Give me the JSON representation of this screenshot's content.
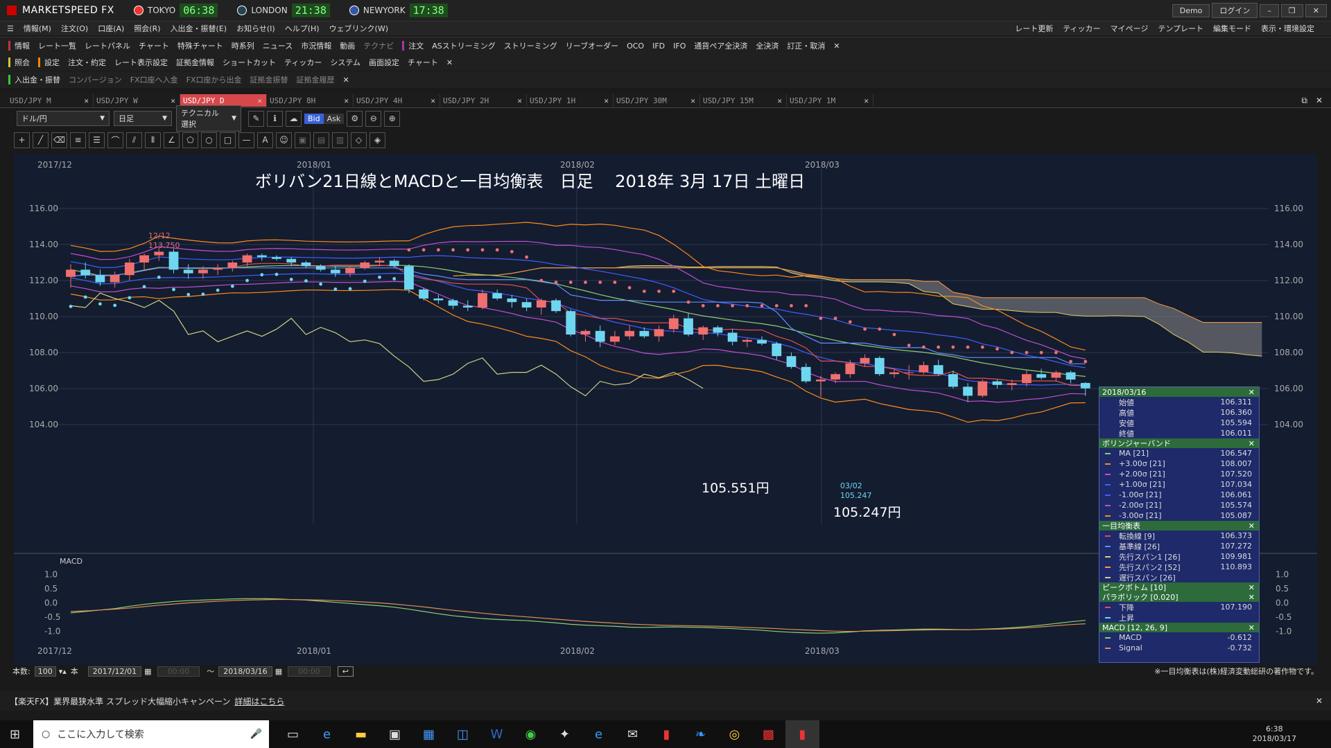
{
  "app": {
    "title": "MARKETSPEED FX",
    "clocks": [
      {
        "city": "TOKYO",
        "time": "06:38"
      },
      {
        "city": "LONDON",
        "time": "21:38"
      },
      {
        "city": "NEWYORK",
        "time": "17:38"
      }
    ],
    "demo": "Demo",
    "login": "ログイン"
  },
  "menu": [
    "情報(M)",
    "注文(O)",
    "口座(A)",
    "照会(R)",
    "入出金・振替(E)",
    "お知らせ(I)",
    "ヘルプ(H)",
    "ウェブリンク(W)"
  ],
  "menu_right": [
    "レート更新",
    "ティッカー",
    "マイページ",
    "テンプレート",
    "編集モード",
    "表示・環境設定"
  ],
  "toolbar1": [
    "情報",
    "レート一覧",
    "レートパネル",
    "チャート",
    "特殊チャート",
    "時系列",
    "ニュース",
    "市況情報",
    "動画",
    "テクナビ",
    "注文",
    "ASストリーミング",
    "ストリーミング",
    "リーブオーダー",
    "OCO",
    "IFD",
    "IFO",
    "通貨ペア全決済",
    "全決済",
    "訂正・取消"
  ],
  "toolbar2": [
    "照会",
    "設定",
    "注文・約定",
    "レート表示設定",
    "証拠金情報",
    "ショートカット",
    "ティッカー",
    "システム",
    "画面設定",
    "チャート"
  ],
  "toolbar3": [
    "入出金・振替",
    "コンバージョン",
    "FX口座へ入金",
    "FX口座から出金",
    "証拠金振替",
    "証拠金履歴"
  ],
  "tabs": [
    "USD/JPY M",
    "USD/JPY W",
    "USD/JPY D",
    "USD/JPY 8H",
    "USD/JPY 4H",
    "USD/JPY 2H",
    "USD/JPY 1H",
    "USD/JPY 30M",
    "USD/JPY 15M",
    "USD/JPY 1M"
  ],
  "active_tab": 2,
  "controls": {
    "pair": "ドル/円",
    "period": "日足",
    "technical": "テクニカル選択",
    "bid": "Bid",
    "ask": "Ask"
  },
  "chart": {
    "annotation_title": "ボリバン21日線とMACDと一目均衡表　日足　 2018年 3月 17日 土曜日",
    "top_dates": [
      "2017/12",
      "2018/01",
      "2018/02",
      "2018/03"
    ],
    "bottom_dates": [
      "2017/12",
      "2018/01",
      "2018/02",
      "2018/03"
    ],
    "y_ticks": [
      "116.00",
      "114.00",
      "112.00",
      "110.00",
      "108.00",
      "106.00",
      "104.00"
    ],
    "macd_label": "MACD",
    "macd_ticks": [
      "1.0",
      "0.5",
      "0.0",
      "-0.5",
      "-1.0"
    ],
    "peak_label_date": "12/12",
    "peak_label_value": "113.750",
    "low_label_date": "03/02",
    "low_label_value": "105.247",
    "callout_1": "105.551円",
    "callout_2": "105.247円",
    "colors": {
      "up": "#ef6f6f",
      "down": "#6fd6ef",
      "bg": "#141c30"
    }
  },
  "chart_data": {
    "type": "candlestick",
    "x_start": "2017/12/01",
    "x_end": "2018/03/16",
    "ylim": [
      102.5,
      117.5
    ],
    "ohlc": [
      [
        112.2,
        112.9,
        111.6,
        112.6
      ],
      [
        112.6,
        113.0,
        112.1,
        112.3
      ],
      [
        112.3,
        112.6,
        111.7,
        111.9
      ],
      [
        111.9,
        112.5,
        111.6,
        112.3
      ],
      [
        112.3,
        113.2,
        112.0,
        113.0
      ],
      [
        113.0,
        113.5,
        112.6,
        113.4
      ],
      [
        113.4,
        113.8,
        113.1,
        113.6
      ],
      [
        113.6,
        113.75,
        112.4,
        112.6
      ],
      [
        112.6,
        112.9,
        112.1,
        112.4
      ],
      [
        112.4,
        112.8,
        112.1,
        112.6
      ],
      [
        112.6,
        112.9,
        112.3,
        112.7
      ],
      [
        112.7,
        113.1,
        112.5,
        113.0
      ],
      [
        113.0,
        113.5,
        112.8,
        113.4
      ],
      [
        113.4,
        113.5,
        113.1,
        113.3
      ],
      [
        113.3,
        113.4,
        113.1,
        113.2
      ],
      [
        113.2,
        113.3,
        112.8,
        113.0
      ],
      [
        113.0,
        113.1,
        112.7,
        112.8
      ],
      [
        112.8,
        112.9,
        112.5,
        112.6
      ],
      [
        112.6,
        112.8,
        112.2,
        112.4
      ],
      [
        112.4,
        112.8,
        112.2,
        112.7
      ],
      [
        112.7,
        113.1,
        112.6,
        113.0
      ],
      [
        113.0,
        113.3,
        112.8,
        113.1
      ],
      [
        113.1,
        113.2,
        112.7,
        112.8
      ],
      [
        112.8,
        112.9,
        111.3,
        111.5
      ],
      [
        111.5,
        111.6,
        110.9,
        111.0
      ],
      [
        111.0,
        111.2,
        110.7,
        110.9
      ],
      [
        110.9,
        111.0,
        110.4,
        110.6
      ],
      [
        110.6,
        110.9,
        110.3,
        110.5
      ],
      [
        110.5,
        111.5,
        110.4,
        111.3
      ],
      [
        111.3,
        111.5,
        110.9,
        111.0
      ],
      [
        111.0,
        111.2,
        110.5,
        110.8
      ],
      [
        110.8,
        111.0,
        110.3,
        110.5
      ],
      [
        110.5,
        111.0,
        110.1,
        110.9
      ],
      [
        110.9,
        111.0,
        110.2,
        110.3
      ],
      [
        110.3,
        110.4,
        108.9,
        109.0
      ],
      [
        109.0,
        109.3,
        108.6,
        109.2
      ],
      [
        109.2,
        109.5,
        108.3,
        108.6
      ],
      [
        108.6,
        109.2,
        108.4,
        108.9
      ],
      [
        108.9,
        109.5,
        108.7,
        109.2
      ],
      [
        109.2,
        109.4,
        108.8,
        108.9
      ],
      [
        108.9,
        109.5,
        108.6,
        109.3
      ],
      [
        109.3,
        110.1,
        109.1,
        109.9
      ],
      [
        109.9,
        110.2,
        108.9,
        109.0
      ],
      [
        109.0,
        109.5,
        108.7,
        109.4
      ],
      [
        109.4,
        109.5,
        108.9,
        109.1
      ],
      [
        109.1,
        109.3,
        108.4,
        108.6
      ],
      [
        108.6,
        108.8,
        108.3,
        108.7
      ],
      [
        108.7,
        108.9,
        108.4,
        108.5
      ],
      [
        108.5,
        108.6,
        107.6,
        107.8
      ],
      [
        107.8,
        108.0,
        107.1,
        107.2
      ],
      [
        107.2,
        107.4,
        106.3,
        106.4
      ],
      [
        106.4,
        106.7,
        105.55,
        106.5
      ],
      [
        106.5,
        106.9,
        106.3,
        106.8
      ],
      [
        106.8,
        107.6,
        106.6,
        107.4
      ],
      [
        107.4,
        107.9,
        107.2,
        107.7
      ],
      [
        107.7,
        107.8,
        106.7,
        106.8
      ],
      [
        106.8,
        107.1,
        106.6,
        106.9
      ],
      [
        106.9,
        107.3,
        106.5,
        106.9
      ],
      [
        106.9,
        107.5,
        106.8,
        107.3
      ],
      [
        107.3,
        107.6,
        106.7,
        106.8
      ],
      [
        106.8,
        107.0,
        106.0,
        106.1
      ],
      [
        106.1,
        106.3,
        105.247,
        105.6
      ],
      [
        105.6,
        106.5,
        105.5,
        106.4
      ],
      [
        106.4,
        106.5,
        106.0,
        106.2
      ],
      [
        106.2,
        106.5,
        105.9,
        106.3
      ],
      [
        106.3,
        107.0,
        106.1,
        106.8
      ],
      [
        106.8,
        107.1,
        106.5,
        106.6
      ],
      [
        106.6,
        107.0,
        106.4,
        106.9
      ],
      [
        106.9,
        107.0,
        106.3,
        106.5
      ],
      [
        106.311,
        106.36,
        105.594,
        106.011
      ]
    ],
    "macd": [
      -0.35,
      -0.3,
      -0.25,
      -0.2,
      -0.12,
      -0.05,
      0.0,
      0.05,
      0.08,
      0.1,
      0.12,
      0.14,
      0.15,
      0.15,
      0.14,
      0.12,
      0.1,
      0.06,
      0.02,
      -0.02,
      -0.06,
      -0.1,
      -0.15,
      -0.22,
      -0.3,
      -0.38,
      -0.45,
      -0.5,
      -0.55,
      -0.58,
      -0.6,
      -0.62,
      -0.66,
      -0.7,
      -0.75,
      -0.78,
      -0.8,
      -0.82,
      -0.85,
      -0.86,
      -0.85,
      -0.84,
      -0.85,
      -0.86,
      -0.88,
      -0.9,
      -0.93,
      -0.96,
      -1.0,
      -1.03,
      -1.05,
      -1.06,
      -1.05,
      -1.02,
      -0.98,
      -0.96,
      -0.95,
      -0.93,
      -0.92,
      -0.92,
      -0.93,
      -0.94,
      -0.92,
      -0.9,
      -0.87,
      -0.83,
      -0.78,
      -0.72,
      -0.66,
      -0.612
    ],
    "signal": [
      -0.3,
      -0.28,
      -0.25,
      -0.22,
      -0.18,
      -0.13,
      -0.08,
      -0.04,
      0.0,
      0.03,
      0.06,
      0.08,
      0.1,
      0.11,
      0.12,
      0.12,
      0.11,
      0.1,
      0.08,
      0.06,
      0.03,
      0.0,
      -0.04,
      -0.09,
      -0.14,
      -0.2,
      -0.26,
      -0.31,
      -0.36,
      -0.41,
      -0.45,
      -0.49,
      -0.53,
      -0.57,
      -0.61,
      -0.65,
      -0.68,
      -0.71,
      -0.74,
      -0.76,
      -0.78,
      -0.79,
      -0.8,
      -0.81,
      -0.82,
      -0.84,
      -0.86,
      -0.88,
      -0.9,
      -0.93,
      -0.95,
      -0.97,
      -0.99,
      -1.0,
      -0.99,
      -0.98,
      -0.97,
      -0.96,
      -0.95,
      -0.94,
      -0.94,
      -0.94,
      -0.93,
      -0.92,
      -0.9,
      -0.87,
      -0.84,
      -0.8,
      -0.76,
      -0.732
    ]
  },
  "info_panel": {
    "date": "2018/03/16",
    "ohlc": [
      [
        "始値",
        "106.311"
      ],
      [
        "高値",
        "106.360"
      ],
      [
        "安値",
        "105.594"
      ],
      [
        "終値",
        "106.011"
      ]
    ],
    "bb_title": "ボリンジャーバンド",
    "bb": [
      [
        "MA [21]",
        "106.547",
        "#8fd070"
      ],
      [
        "+3.00σ [21]",
        "108.007",
        "#ff8c1a"
      ],
      [
        "+2.00σ [21]",
        "107.520",
        "#c050d0"
      ],
      [
        "+1.00σ [21]",
        "107.034",
        "#4060ff"
      ],
      [
        "-1.00σ [21]",
        "106.061",
        "#4060ff"
      ],
      [
        "-2.00σ [21]",
        "105.574",
        "#c050d0"
      ],
      [
        "-3.00σ [21]",
        "105.087",
        "#ff8c1a"
      ]
    ],
    "ich_title": "一目均衡表",
    "ich": [
      [
        "転換線 [9]",
        "106.373",
        "#e05050"
      ],
      [
        "基準線 [26]",
        "107.272",
        "#6090ff"
      ],
      [
        "先行スパン1 [26]",
        "109.981",
        "#e0d060"
      ],
      [
        "先行スパン2 [52]",
        "110.893",
        "#ff9a40"
      ],
      [
        "遅行スパン [26]",
        "",
        "#d0d080"
      ]
    ],
    "peak_title": "ピークボトム [10]",
    "para_title": "パラボリック [0.020]",
    "para": [
      [
        "下降",
        "107.190",
        "#e05050"
      ],
      [
        "上昇",
        "",
        "#6fd6ef"
      ]
    ],
    "macd_title": "MACD [12, 26, 9]",
    "macd": [
      [
        "MACD",
        "-0.612",
        "#90d070"
      ],
      [
        "Signal",
        "-0.732",
        "#e09050"
      ]
    ]
  },
  "bottom": {
    "count_label": "本数:",
    "count": "100",
    "unit": "本",
    "from": "2017/12/01",
    "to": "2018/03/16",
    "copyright": "※一目均衡表は(株)経済変動総研の著作物です。"
  },
  "banner": {
    "text": "【楽天FX】業界最狭水準 スプレッド大幅縮小キャンペーン",
    "link": "詳細はこちら"
  },
  "taskbar": {
    "search_placeholder": "ここに入力して検索",
    "time": "6:38",
    "date": "2018/03/17"
  }
}
